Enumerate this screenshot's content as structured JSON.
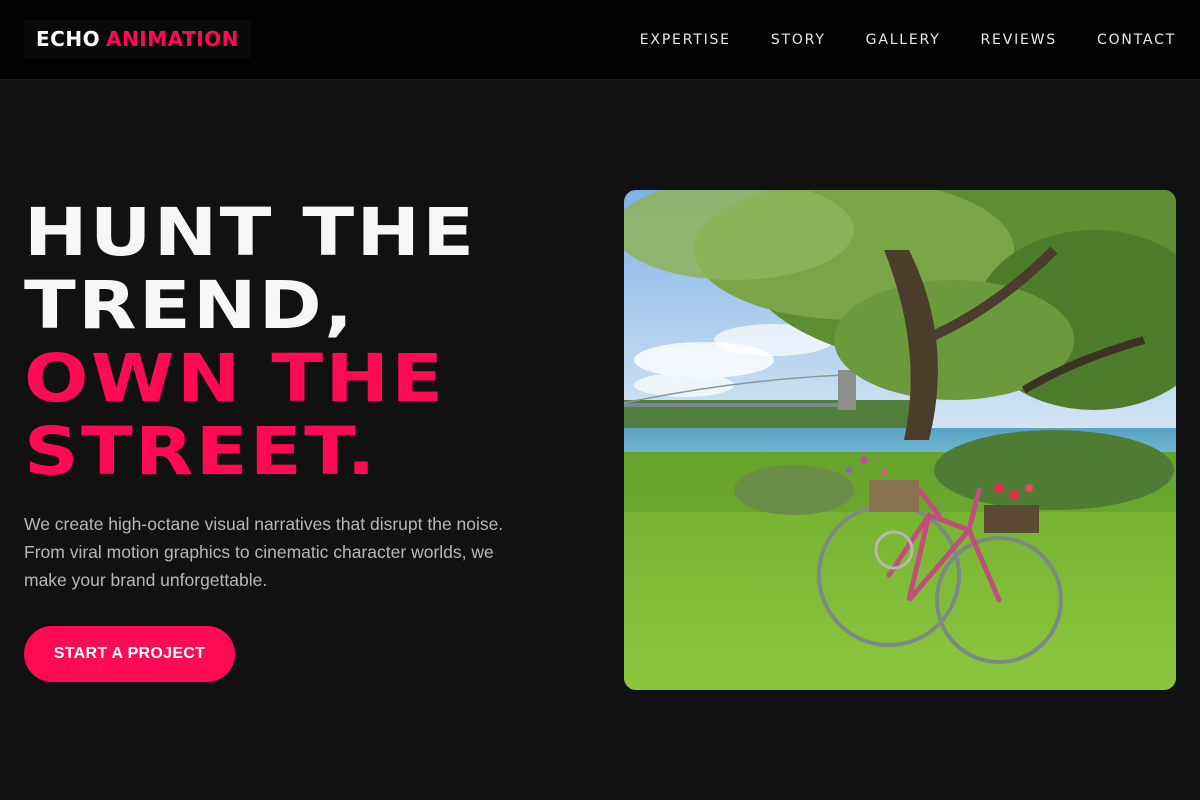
{
  "brand": {
    "first": "ECHO",
    "second": "ANIMATION"
  },
  "nav": {
    "items": [
      {
        "label": "EXPERTISE"
      },
      {
        "label": "STORY"
      },
      {
        "label": "GALLERY"
      },
      {
        "label": "REVIEWS"
      },
      {
        "label": "CONTACT"
      }
    ]
  },
  "hero": {
    "title_lines": [
      "HUNT THE",
      "TREND,",
      "OWN THE",
      "STREET."
    ],
    "description": "We create high-octane visual narratives that disrupt the noise. From viral motion graphics to cinematic character worlds, we make your brand unforgettable.",
    "cta_label": "START A PROJECT"
  },
  "colors": {
    "accent": "#ff0a55",
    "background": "#111111",
    "topbar": "#030303"
  }
}
